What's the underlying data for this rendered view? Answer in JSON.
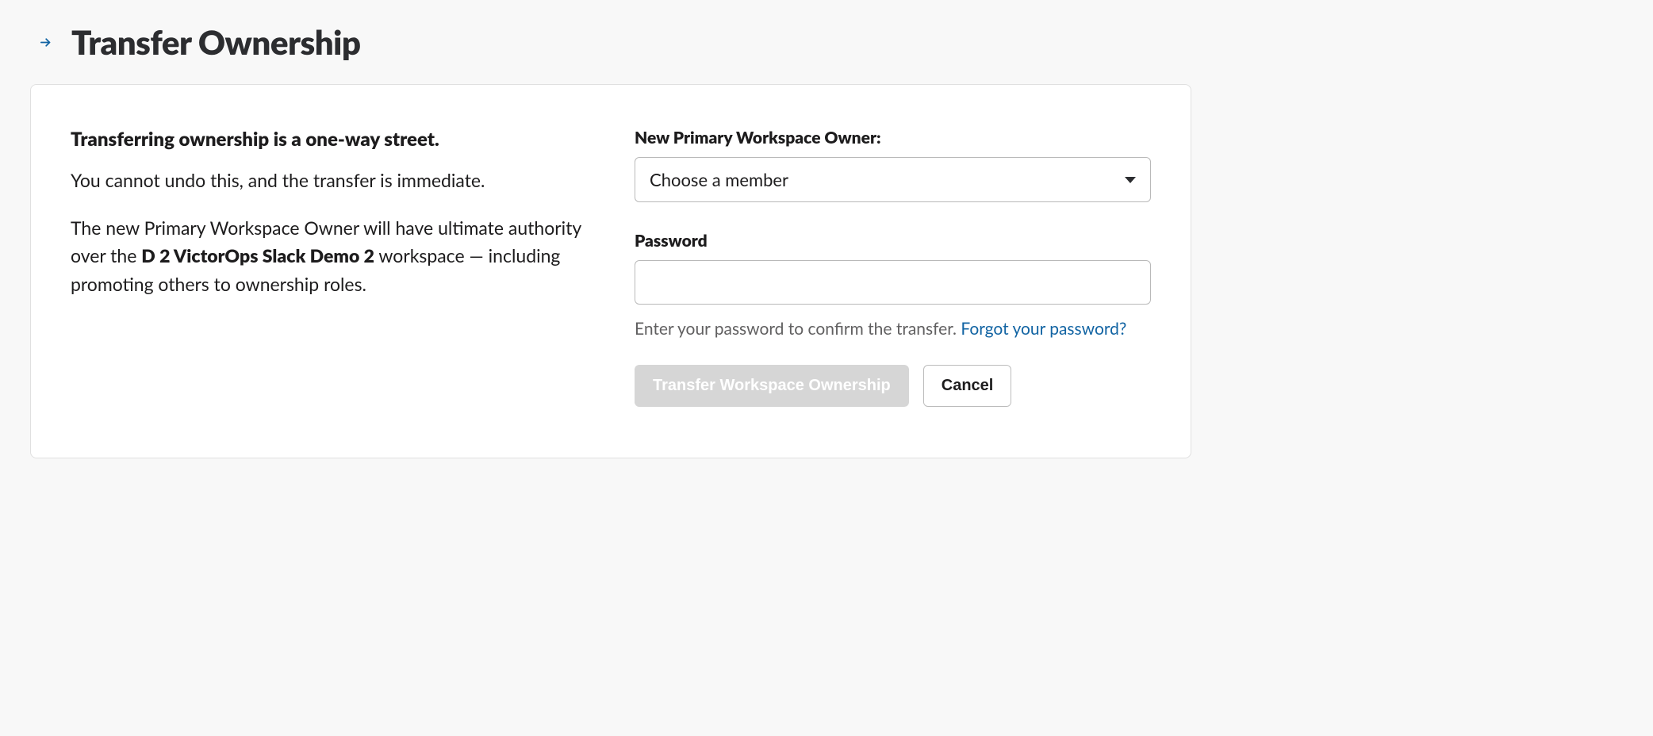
{
  "header": {
    "title": "Transfer Ownership",
    "icon_name": "arrow-right-icon"
  },
  "left": {
    "heading": "Transferring ownership is a one-way street.",
    "para1": "You cannot undo this, and the transfer is immediate.",
    "para2_prefix": "The new Primary Workspace Owner will have ultimate authority over the ",
    "workspace_name": "D 2 VictorOps Slack Demo 2",
    "para2_suffix": " workspace — including promoting others to ownership roles."
  },
  "form": {
    "owner_label": "New Primary Workspace Owner:",
    "owner_placeholder": "Choose a member",
    "password_label": "Password",
    "password_value": "",
    "hint_prefix": "Enter your password to confirm the transfer. ",
    "forgot_link": "Forgot your password?",
    "transfer_button": "Transfer Workspace Ownership",
    "cancel_button": "Cancel"
  }
}
